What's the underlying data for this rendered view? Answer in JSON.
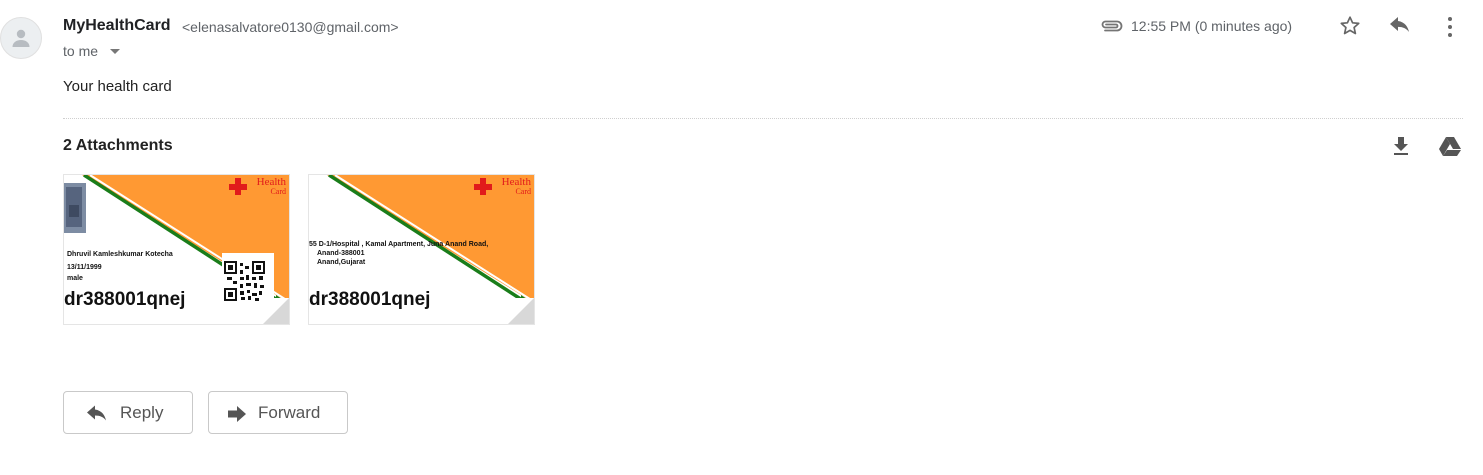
{
  "message": {
    "sender_name": "MyHealthCard",
    "sender_email": "<elenasalvatore0130@gmail.com>",
    "recipient": "to me",
    "timestamp": "12:55 PM (0 minutes ago)",
    "body": "Your health card"
  },
  "attachments": {
    "title": "2 Attachments",
    "items": [
      {
        "brand": "Health",
        "brand_sub": "Card",
        "name": "Dhruvil Kamleshkumar Kotecha",
        "dob": "13/11/1999",
        "gender": "male",
        "card_id": "dr388001qnej"
      },
      {
        "brand": "Health",
        "brand_sub": "Card",
        "address_line1": "55 D-1/Hospital , Kamal Apartment, Juna Anand Road,",
        "address_line2": "Anand-388001",
        "address_line3": "Anand,Gujarat",
        "card_id": "dr388001qnej"
      }
    ]
  },
  "actions": {
    "reply_label": "Reply",
    "forward_label": "Forward"
  },
  "icons": {
    "avatar": "person-icon",
    "attachment": "paperclip-icon",
    "star": "star-icon",
    "reply": "reply-icon",
    "more": "more-vert-icon",
    "download": "download-icon",
    "drive": "drive-icon"
  },
  "colors": {
    "card_orange": "#FF9933",
    "card_green": "#1a7d1a",
    "brand_red": "#e11b1b"
  }
}
